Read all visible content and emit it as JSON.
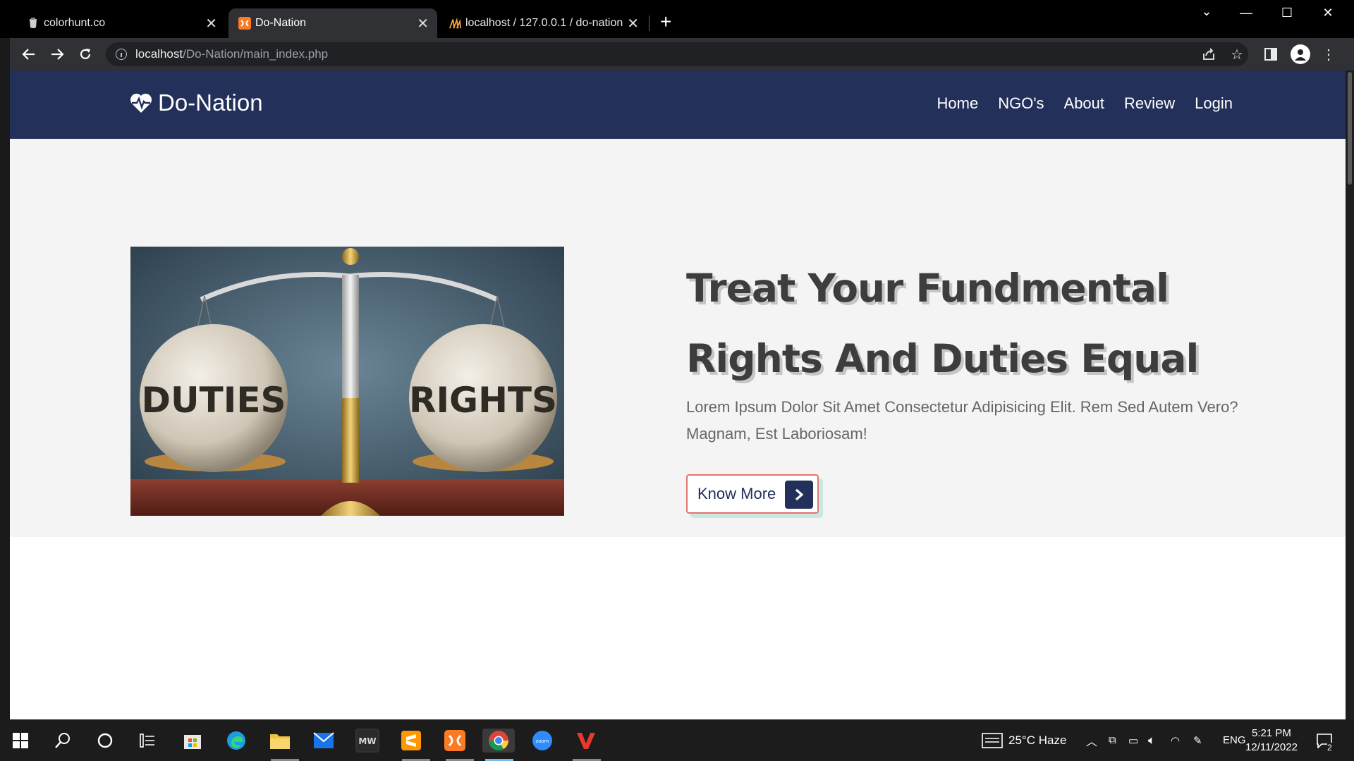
{
  "browser": {
    "tabs": [
      {
        "title": "colorhunt.co",
        "icon": "colorhunt-icon"
      },
      {
        "title": "Do-Nation",
        "icon": "xampp-icon"
      },
      {
        "title": "localhost / 127.0.0.1 / do-nation",
        "icon": "phpmyadmin-icon"
      }
    ],
    "url_host": "localhost",
    "url_path": "/Do-Nation/main_index.php"
  },
  "site": {
    "brand": "Do-Nation",
    "nav": [
      "Home",
      "NGO's",
      "About",
      "Review",
      "Login"
    ],
    "hero": {
      "title_line1": "Treat Your Fundmental",
      "title_line2": "Rights And Duties Equal",
      "text": "Lorem Ipsum Dolor Sit Amet Consectetur Adipisicing Elit. Rem Sed Autem Vero? Magnam, Est Laboriosam!",
      "button": "Know More",
      "image_labels": {
        "left": "DUTIES",
        "right": "RIGHTS"
      }
    }
  },
  "taskbar": {
    "weather": "25°C Haze",
    "language": "ENG",
    "time": "5:21 PM",
    "date": "12/11/2022",
    "notifications": "2"
  },
  "colors": {
    "header": "#22305a",
    "hero_bg": "#f4f4f4",
    "button_border": "#e57373"
  }
}
